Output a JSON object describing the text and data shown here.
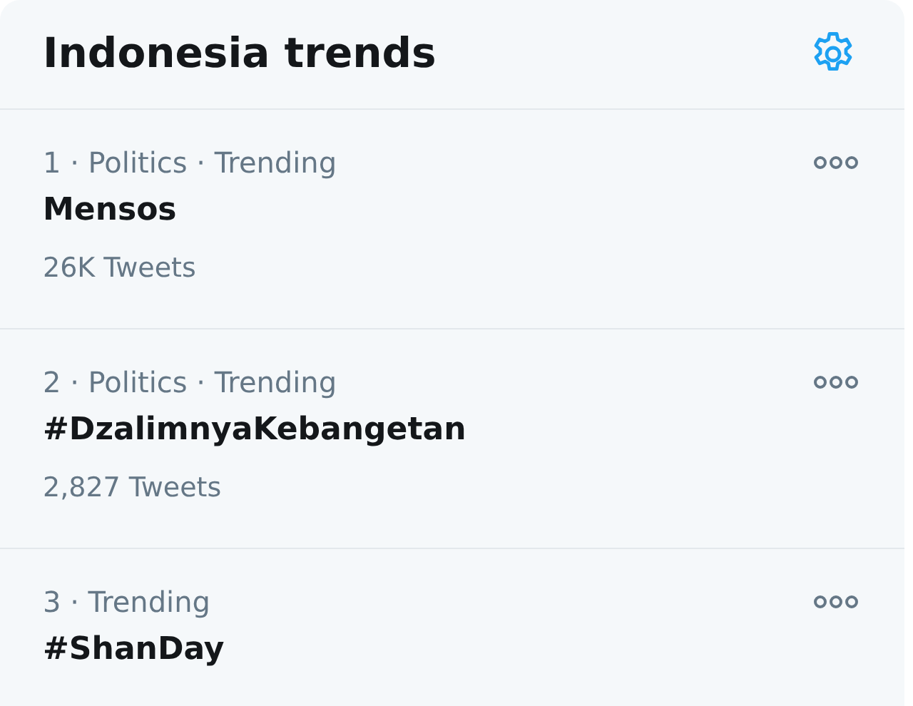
{
  "header": {
    "title": "Indonesia trends"
  },
  "trends": [
    {
      "context": "1 · Politics · Trending",
      "name": "Mensos",
      "count": "26K Tweets"
    },
    {
      "context": "2 · Politics · Trending",
      "name": "#DzalimnyaKebangetan",
      "count": "2,827 Tweets"
    },
    {
      "context": "3 · Trending",
      "name": "#ShanDay"
    }
  ]
}
